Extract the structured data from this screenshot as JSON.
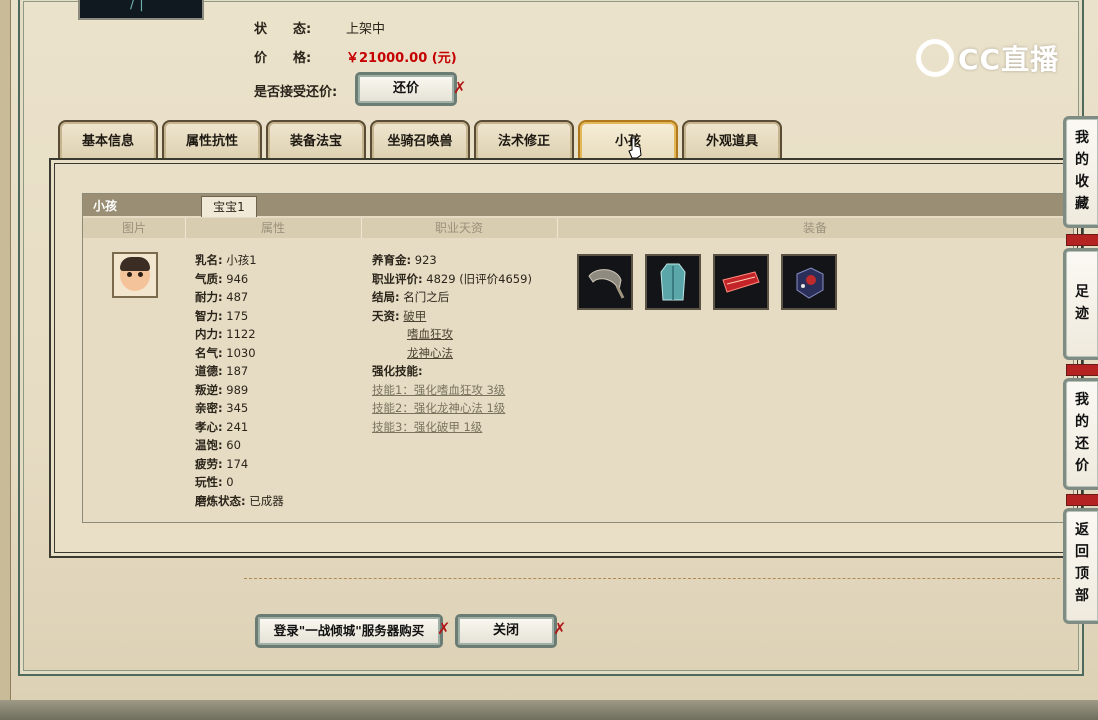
{
  "header": {
    "status_label": "状　　态:",
    "status_value": "上架中",
    "price_label": "价　　格:",
    "price_value": "￥21000.00 (元)",
    "bargain_label": "是否接受还价:",
    "bargain_button": "还价"
  },
  "logo": {
    "text": "CC直播"
  },
  "tabs": [
    {
      "label": "基本信息"
    },
    {
      "label": "属性抗性"
    },
    {
      "label": "装备法宝"
    },
    {
      "label": "坐骑召唤兽"
    },
    {
      "label": "法术修正"
    },
    {
      "label": "小孩",
      "active": true
    },
    {
      "label": "外观道具"
    }
  ],
  "child_panel": {
    "title": "小孩",
    "subtab": "宝宝1",
    "columns": [
      "图片",
      "属性",
      "职业天资",
      "装备"
    ],
    "attributes": [
      {
        "key": "乳名:",
        "value": "小孩1"
      },
      {
        "key": "气质:",
        "value": "946"
      },
      {
        "key": "耐力:",
        "value": "487"
      },
      {
        "key": "智力:",
        "value": "175"
      },
      {
        "key": "内力:",
        "value": "1122"
      },
      {
        "key": "名气:",
        "value": "1030"
      },
      {
        "key": "道德:",
        "value": "187"
      },
      {
        "key": "叛逆:",
        "value": "989"
      },
      {
        "key": "亲密:",
        "value": "345"
      },
      {
        "key": "孝心:",
        "value": "241"
      },
      {
        "key": "温饱:",
        "value": "60"
      },
      {
        "key": "疲劳:",
        "value": "174"
      },
      {
        "key": "玩性:",
        "value": "0"
      },
      {
        "key": "磨炼状态:",
        "value": "已成器"
      }
    ],
    "career": {
      "gold_key": "养育金:",
      "gold_value": "923",
      "rating_key": "职业评价:",
      "rating_value": "4829 (旧评价4659)",
      "ending_key": "结局:",
      "ending_value": "名门之后",
      "talent_key": "天资:",
      "talents": [
        "破甲",
        "嗜血狂攻",
        "龙神心法"
      ],
      "skills_key": "强化技能:",
      "skills": [
        "技能1：强化嗜血狂攻 3级",
        "技能2：强化龙神心法 1级",
        "技能3：强化破甲 1级"
      ]
    },
    "equipment_icons": [
      "rope-belt-icon",
      "blue-robe-icon",
      "red-scroll-icon",
      "dark-cube-icon"
    ]
  },
  "footer": {
    "login_buy_button": "登录\"一战倾城\"服务器购买",
    "close_button": "关闭"
  },
  "sidebar": [
    {
      "label": "我的收藏"
    },
    {
      "label": "足迹"
    },
    {
      "label": "我的还价"
    },
    {
      "label": "返回顶部"
    }
  ],
  "colors": {
    "price": "#c40000",
    "accent_tab": "#b07a1c",
    "close_mark": "#b01818"
  }
}
